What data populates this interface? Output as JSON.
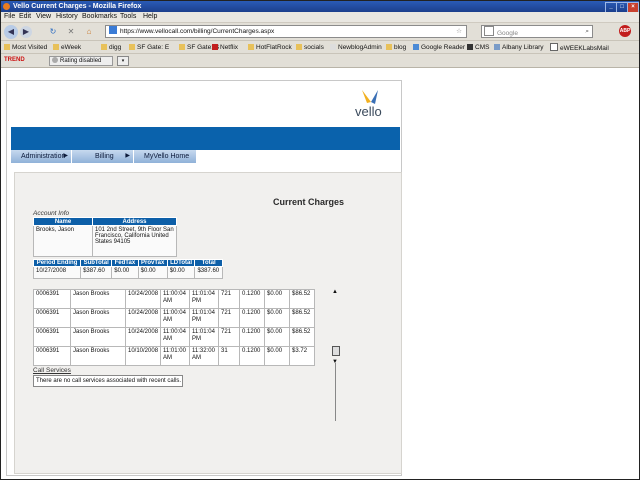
{
  "window": {
    "title": "Vello Current Charges - Mozilla Firefox"
  },
  "menu": [
    "File",
    "Edit",
    "View",
    "History",
    "Bookmarks",
    "Tools",
    "Help"
  ],
  "nav": {
    "url": "https://www.vellocall.com/billing/CurrentCharges.aspx",
    "search_placeholder": "Google"
  },
  "bookmarks": [
    "Most Visited",
    "eWeek",
    "digg",
    "SF Gate: E",
    "SF Gate: S",
    "Netflix",
    "HotFlatRock",
    "socials",
    "NewblogAdmin",
    "blog",
    "Google Reader",
    "CMS",
    "Albany Library",
    "eWEEKLabsMail"
  ],
  "toolbar": {
    "trend": "TREND",
    "rating": "Rating disabled"
  },
  "site": {
    "logo_text": "vello",
    "tabs": [
      "Administration",
      "Billing",
      "MyVello Home"
    ],
    "heading": "Current Charges"
  },
  "account": {
    "label": "Account Info",
    "headers": [
      "Name",
      "Address"
    ],
    "name": "Brooks, Jason",
    "address": "101 2nd Street, 9th Floor San Francisco, California United States 94105"
  },
  "totals": {
    "headers": [
      "Period Ending",
      "SubTotal",
      "FedTax",
      "ProvTax",
      "LDTotal",
      "Total"
    ],
    "row": [
      "10/27/2008",
      "$387.60",
      "$0.00",
      "$0.00",
      "$0.00",
      "$387.60"
    ]
  },
  "calls": [
    [
      "0006391",
      "Jason Brooks",
      "10/24/2008",
      "11:00:04 AM",
      "11:01:04 PM",
      "721",
      "0.1200",
      "$0.00",
      "$86.52"
    ],
    [
      "0006391",
      "Jason Brooks",
      "10/24/2008",
      "11:00:04 AM",
      "11:01:04 PM",
      "721",
      "0.1200",
      "$0.00",
      "$86.52"
    ],
    [
      "0006391",
      "Jason Brooks",
      "10/24/2008",
      "11:00:04 AM",
      "11:01:04 PM",
      "721",
      "0.1200",
      "$0.00",
      "$86.52"
    ],
    [
      "0006391",
      "Jason Brooks",
      "10/10/2008",
      "11:01:00 AM",
      "11:32:00 AM",
      "31",
      "0.1200",
      "$0.00",
      "$3.72"
    ]
  ],
  "call_services": {
    "label": "Call Services",
    "message": "There are no call services associated with recent calls."
  }
}
